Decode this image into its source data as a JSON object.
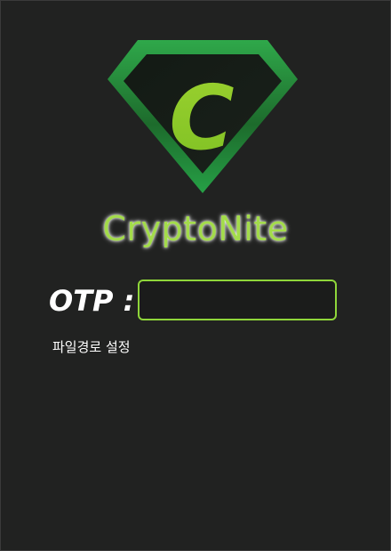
{
  "app": {
    "logo_letter": "C",
    "title": "CryptoNite"
  },
  "otp": {
    "label": "OTP :",
    "value": "",
    "placeholder": ""
  },
  "settings": {
    "path_setting_label": "파일경로 설정"
  },
  "colors": {
    "background": "#212221",
    "accent_green": "#8fd63a",
    "logo_dark_green": "#1f7a2e",
    "logo_bright_green": "#4ec94a",
    "title_green": "#a3dc4a"
  },
  "icons": {
    "logo": "crest-c-logo-icon"
  }
}
